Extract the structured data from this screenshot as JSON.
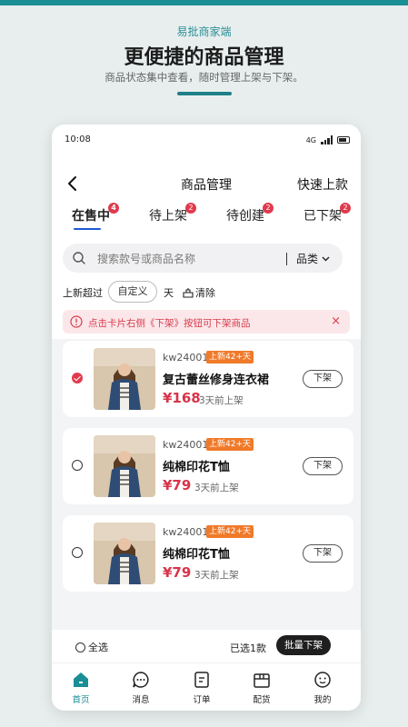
{
  "header": {
    "brand": "易批商家端",
    "headline": "更便捷的商品管理",
    "subline": "商品状态集中查看，随时管理上架与下架。"
  },
  "status_bar": {
    "time": "10:08",
    "network": "4G"
  },
  "nav": {
    "title": "商品管理",
    "quick_action": "快速上款"
  },
  "tabs": [
    {
      "label": "在售中",
      "badge": "4"
    },
    {
      "label": "待上架",
      "badge": "2"
    },
    {
      "label": "待创建",
      "badge": "2"
    },
    {
      "label": "已下架",
      "badge": "2"
    }
  ],
  "search": {
    "placeholder": "搜索款号或商品名称",
    "category": "品类"
  },
  "filter": {
    "label": "上新超过",
    "custom": "自定义",
    "unit": "天",
    "clear": "清除"
  },
  "notice": {
    "text": "点击卡片右侧《下架》按钮可下架商品",
    "close": "×"
  },
  "products": [
    {
      "code": "kw24001",
      "tag": "上新42+天",
      "name": "复古蕾丝修身连衣裙",
      "price": "¥168",
      "when": "3天前上架",
      "action": "下架",
      "selected": true
    },
    {
      "code": "kw24001",
      "tag": "上新42+天",
      "name": "纯棉印花T恤",
      "price": "¥79",
      "when": "3天前上架",
      "action": "下架",
      "selected": false
    },
    {
      "code": "kw24001",
      "tag": "上新42+天",
      "name": "纯棉印花T恤",
      "price": "¥79",
      "when": "3天前上架",
      "action": "下架",
      "selected": false
    }
  ],
  "bottom": {
    "select_all": "全选",
    "selected_count": "已选1款",
    "batch_off": "批量下架"
  },
  "tabbar": [
    {
      "label": "首页",
      "icon": "home-icon",
      "active": true
    },
    {
      "label": "消息",
      "icon": "message-icon",
      "active": false
    },
    {
      "label": "订单",
      "icon": "order-icon",
      "active": false
    },
    {
      "label": "配货",
      "icon": "box-icon",
      "active": false
    },
    {
      "label": "我的",
      "icon": "profile-icon",
      "active": false
    }
  ],
  "colors": {
    "accent": "#1a8e95",
    "price": "#d8334a",
    "tag": "#f07a2a",
    "badge": "#e03a4d"
  }
}
